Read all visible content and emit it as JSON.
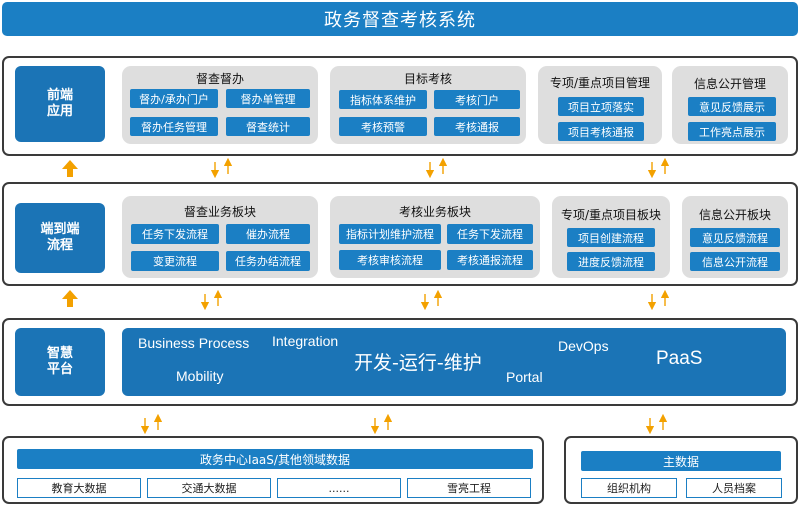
{
  "title": "政务督查考核系统",
  "layers": {
    "front": {
      "label": "前端\n应用",
      "panels": [
        {
          "title": "督查督办",
          "items": [
            "督办/承办门户",
            "督办单管理",
            "督办任务管理",
            "督查统计"
          ]
        },
        {
          "title": "目标考核",
          "items": [
            "指标体系维护",
            "考核门户",
            "考核预警",
            "考核通报"
          ]
        },
        {
          "title": "专项/重点项目管理",
          "items": [
            "项目立项落实",
            "项目考核通报"
          ]
        },
        {
          "title": "信息公开管理",
          "items": [
            "意见反馈展示",
            "工作亮点展示"
          ]
        }
      ]
    },
    "process": {
      "label": "端到端\n流程",
      "panels": [
        {
          "title": "督查业务板块",
          "items": [
            "任务下发流程",
            "催办流程",
            "变更流程",
            "任务办结流程"
          ]
        },
        {
          "title": "考核业务板块",
          "items": [
            "指标计划维护流程",
            "任务下发流程",
            "考核审核流程",
            "考核通报流程"
          ]
        },
        {
          "title": "专项/重点项目板块",
          "items": [
            "项目创建流程",
            "进度反馈流程"
          ]
        },
        {
          "title": "信息公开板块",
          "items": [
            "意见反馈流程",
            "信息公开流程"
          ]
        }
      ]
    },
    "platform": {
      "label": "智慧\n平台",
      "terms": [
        "Business Process",
        "Integration",
        "开发-运行-维护",
        "DevOps",
        "PaaS",
        "Mobility",
        "Portal"
      ]
    },
    "data_left": {
      "header": "政务中心IaaS/其他领域数据",
      "items": [
        "教育大数据",
        "交通大数据",
        "......",
        "雪亮工程"
      ]
    },
    "data_right": {
      "header": "主数据",
      "items": [
        "组织机构",
        "人员档案"
      ]
    }
  },
  "colors": {
    "primary": "#1b7fc4",
    "dark_blue": "#1b74b6",
    "panel_gray": "#dedede",
    "arrow_orange": "#f3a100",
    "border": "#3a3a3a"
  }
}
